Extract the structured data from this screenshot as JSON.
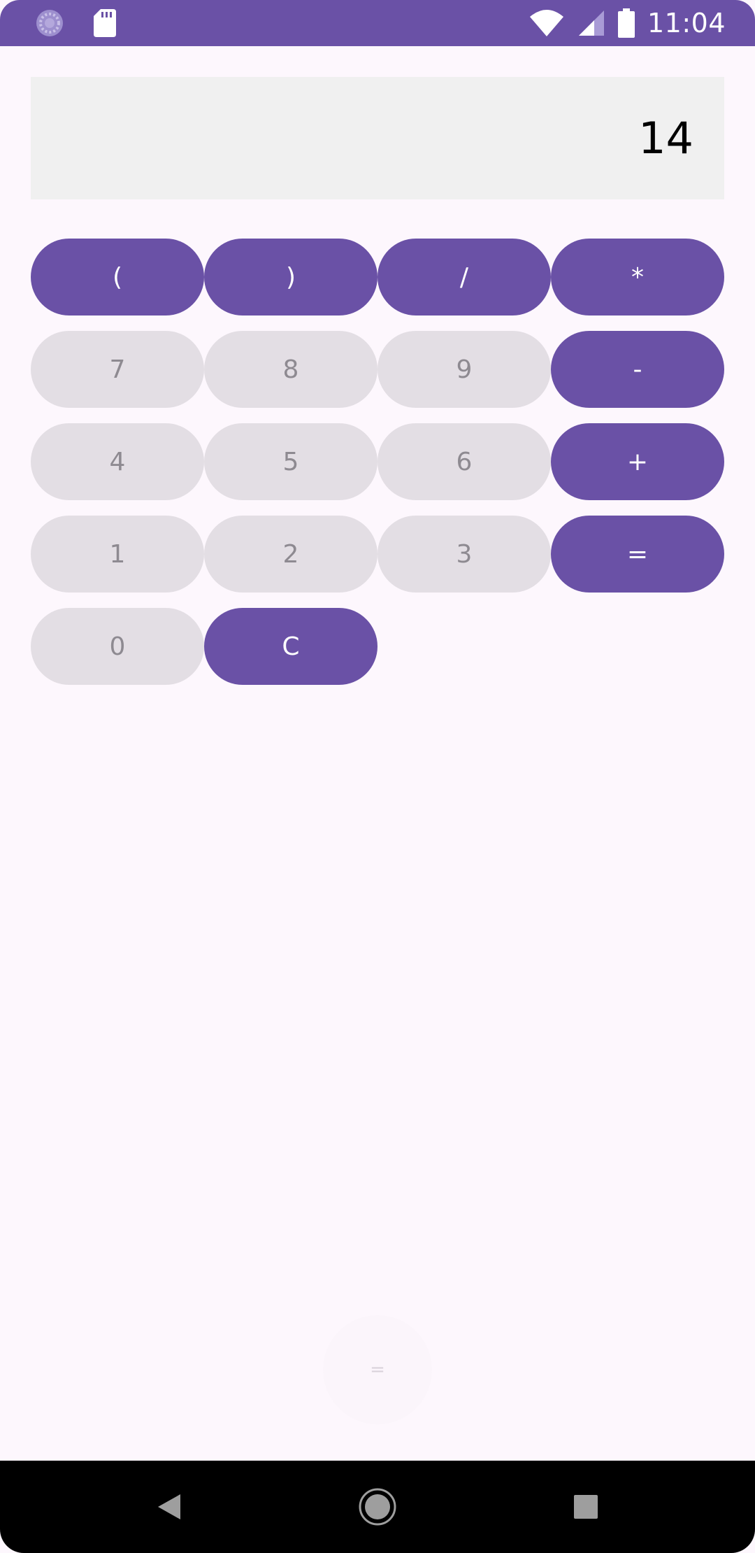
{
  "status_bar": {
    "time": "11:04",
    "left_icons": [
      "sync-icon",
      "sd-card-icon"
    ],
    "right_icons": [
      "wifi-icon",
      "cell-signal-icon",
      "battery-icon"
    ],
    "background": "#6a51a6"
  },
  "display": {
    "value": "14",
    "background": "#f0f0f0"
  },
  "keypad": {
    "rows": [
      [
        {
          "label": "(",
          "style": "op"
        },
        {
          "label": ")",
          "style": "op"
        },
        {
          "label": "/",
          "style": "op"
        },
        {
          "label": "*",
          "style": "op"
        }
      ],
      [
        {
          "label": "7",
          "style": "num"
        },
        {
          "label": "8",
          "style": "num"
        },
        {
          "label": "9",
          "style": "num"
        },
        {
          "label": "-",
          "style": "op"
        }
      ],
      [
        {
          "label": "4",
          "style": "num"
        },
        {
          "label": "5",
          "style": "num"
        },
        {
          "label": "6",
          "style": "num"
        },
        {
          "label": "+",
          "style": "op"
        }
      ],
      [
        {
          "label": "1",
          "style": "num"
        },
        {
          "label": "2",
          "style": "num"
        },
        {
          "label": "3",
          "style": "num"
        },
        {
          "label": "=",
          "style": "op"
        }
      ],
      [
        {
          "label": "0",
          "style": "num"
        },
        {
          "label": "C",
          "style": "op"
        }
      ]
    ],
    "colors": {
      "operator_bg": "#6a51a6",
      "operator_text": "#ffffff",
      "number_bg": "#e3dee4",
      "number_text": "#8e8a91"
    }
  },
  "floating_button": {
    "label": "="
  },
  "nav_bar": {
    "buttons": [
      "back-icon",
      "home-icon",
      "recents-icon"
    ]
  }
}
